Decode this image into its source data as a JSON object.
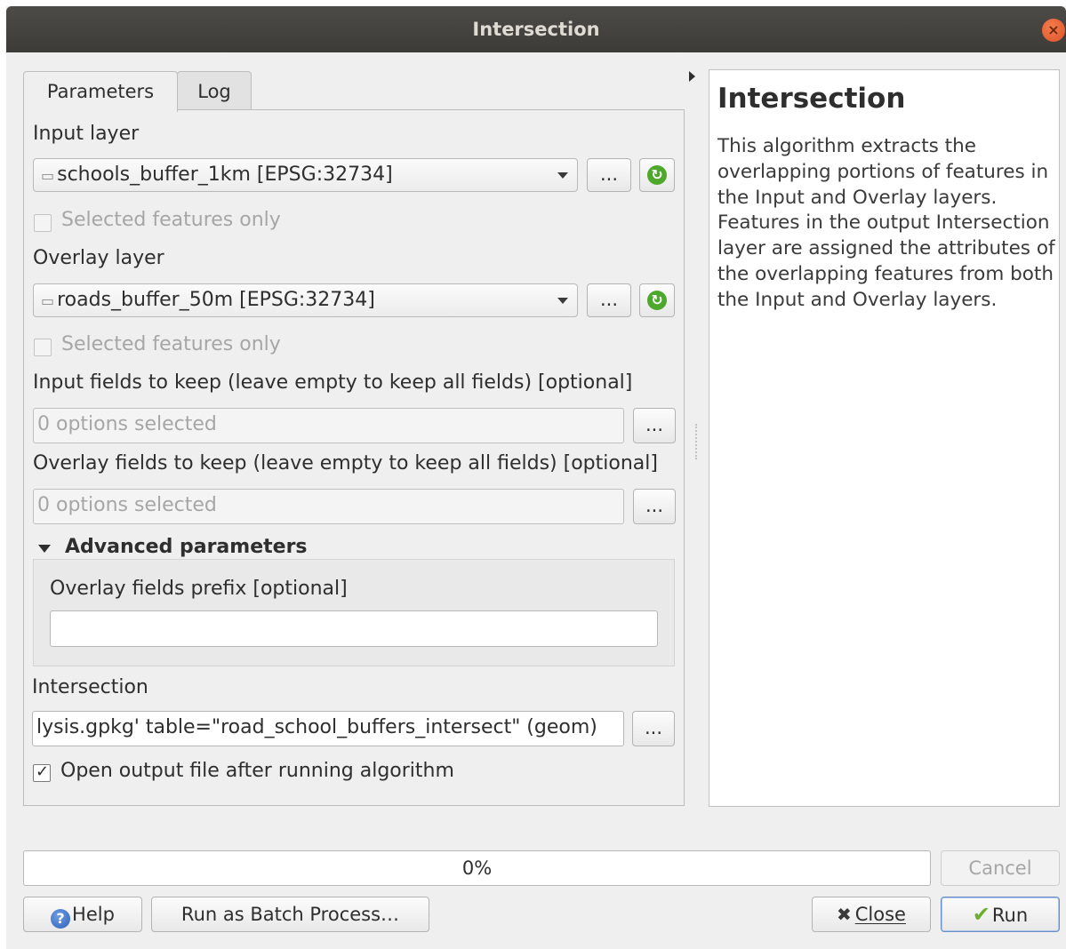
{
  "window": {
    "title": "Intersection"
  },
  "tabs": [
    {
      "label": "Parameters",
      "active": true
    },
    {
      "label": "Log",
      "active": false
    }
  ],
  "parameters": {
    "input_layer_label": "Input layer",
    "input_layer_value": "schools_buffer_1km [EPSG:32734]",
    "input_selected_only": "Selected features only",
    "overlay_layer_label": "Overlay layer",
    "overlay_layer_value": "roads_buffer_50m [EPSG:32734]",
    "overlay_selected_only": "Selected features only",
    "input_fields_label": "Input fields to keep (leave empty to keep all fields) [optional]",
    "input_fields_value": "0 options selected",
    "overlay_fields_label": "Overlay fields to keep (leave empty to keep all fields) [optional]",
    "overlay_fields_value": "0 options selected",
    "advanced_label": "Advanced parameters",
    "prefix_label": "Overlay fields prefix [optional]",
    "prefix_value": "",
    "output_label": "Intersection",
    "output_value": "lysis.gpkg' table=\"road_school_buffers_intersect\" (geom)",
    "open_output_label": "Open output file after running algorithm",
    "open_output_checked": true,
    "ellipsis": "..."
  },
  "help": {
    "title": "Intersection",
    "text": "This algorithm extracts the overlapping portions of features in the Input and Overlay layers. Features in the output Intersection layer are assigned the attributes of the overlapping features from both the Input and Overlay layers."
  },
  "progress": {
    "percent": 0,
    "label": "0%"
  },
  "buttons": {
    "cancel": "Cancel",
    "help": "Help",
    "batch": "Run as Batch Process…",
    "close": "Close",
    "run": "Run"
  },
  "colors": {
    "titlebar": "#3c3b37",
    "close_button": "#e0522a",
    "refresh_icon": "#4ea82c",
    "help_icon": "#2d5fb8",
    "run_check": "#6cae2f"
  }
}
